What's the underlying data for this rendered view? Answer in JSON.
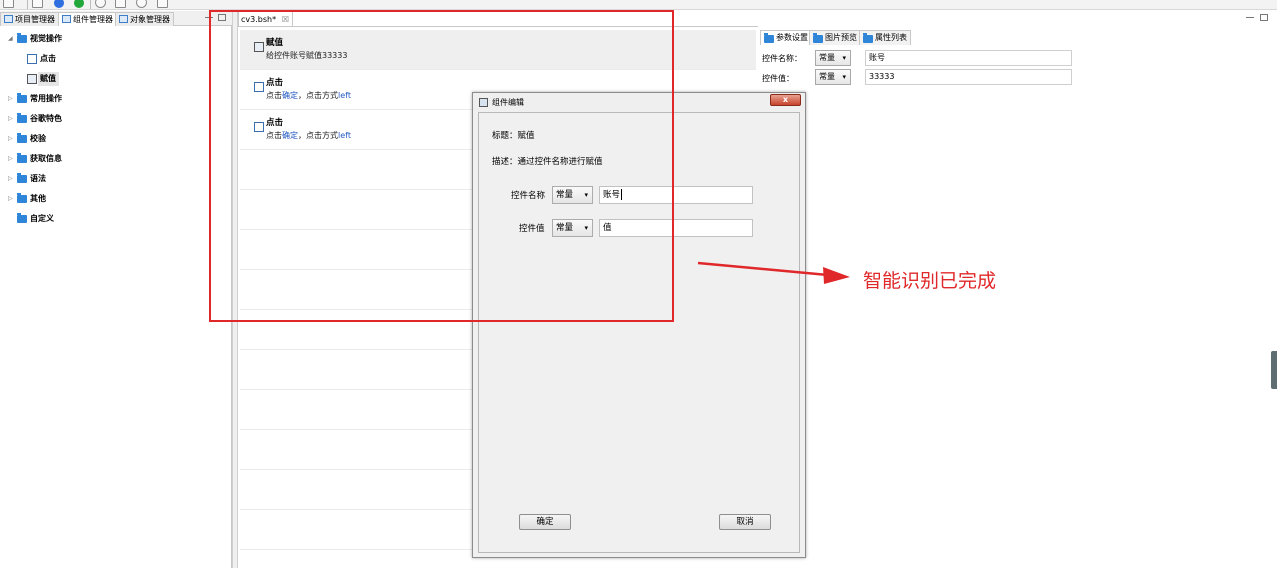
{
  "toolbar": {
    "icons": [
      "new-icon",
      "save-icon",
      "record-icon",
      "run-icon",
      "play-icon",
      "step-icon",
      "debug-icon",
      "grid-icon"
    ]
  },
  "left_panel": {
    "tabs": [
      {
        "label": "项目管理器"
      },
      {
        "label": "组件管理器"
      },
      {
        "label": "对象管理器"
      }
    ],
    "tree": [
      {
        "label": "视觉操作",
        "expanded": true
      },
      {
        "label": "点击",
        "child": true
      },
      {
        "label": "赋值",
        "child": true,
        "selected": true
      },
      {
        "label": "常用操作"
      },
      {
        "label": "谷歌特色"
      },
      {
        "label": "校验"
      },
      {
        "label": "获取信息"
      },
      {
        "label": "语法"
      },
      {
        "label": "其他"
      },
      {
        "label": "自定义"
      }
    ]
  },
  "editor": {
    "tab_label": "cv3.bsh*",
    "tab_close": "☒",
    "rows": [
      {
        "title": "赋值",
        "desc": "给控件账号赋值33333"
      },
      {
        "title": "点击",
        "desc_pre": "点击",
        "desc_link": "确定",
        "desc_mid": "，点击方式",
        "desc_mode": "left"
      },
      {
        "title": "点击",
        "desc_pre": "点击",
        "desc_link": "确定",
        "desc_mid": "，点击方式",
        "desc_mode": "left"
      }
    ]
  },
  "right_panel": {
    "tabs": [
      {
        "label": "参数设置"
      },
      {
        "label": "图片预览"
      },
      {
        "label": "属性列表"
      }
    ],
    "params": [
      {
        "label": "控件名称：",
        "type": "常量",
        "value": "账号"
      },
      {
        "label": "控件值：",
        "type": "常量",
        "value": "33333"
      }
    ]
  },
  "dialog": {
    "title": "组件编辑",
    "close": "x",
    "title_line": "标题：赋值",
    "desc_line": "描述：通过控件名称进行赋值",
    "fields": [
      {
        "label": "控件名称",
        "type": "常量",
        "value": "账号"
      },
      {
        "label": "控件值",
        "type": "常量",
        "value": "值"
      }
    ],
    "ok_label": "确定",
    "cancel_label": "取消"
  },
  "annotation": {
    "text": "智能识别已完成",
    "color": "#e0282a"
  }
}
